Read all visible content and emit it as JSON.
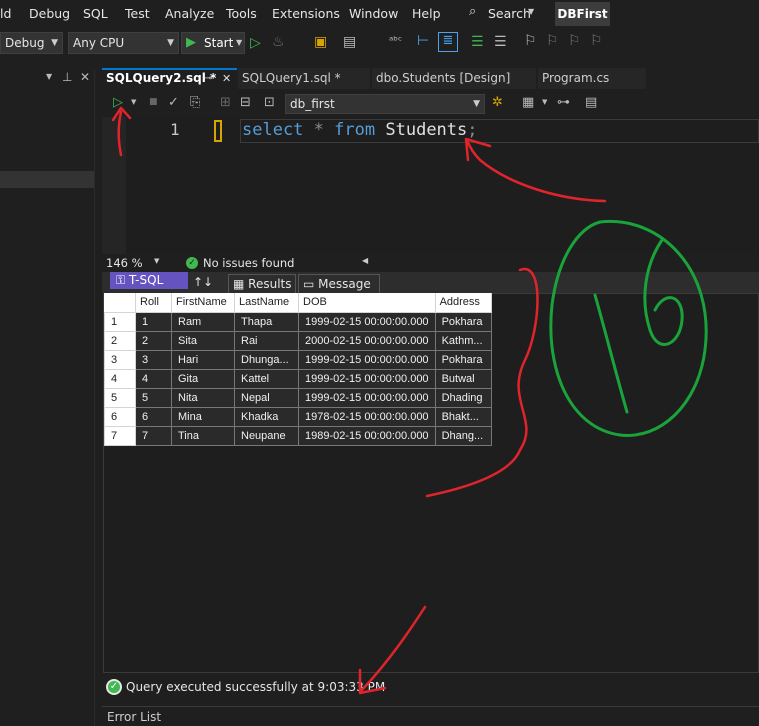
{
  "menu": [
    "ld",
    "Debug",
    "SQL",
    "Test",
    "Analyze",
    "Tools",
    "Extensions",
    "Window",
    "Help"
  ],
  "search_label": "Search",
  "solution_badge": "DBFirst",
  "toolbar": {
    "config": "Debug",
    "platform": "Any CPU",
    "start_label": "Start"
  },
  "tabs": [
    {
      "label": "SQLQuery2.sql *",
      "active": true
    },
    {
      "label": "SQLQuery1.sql *",
      "active": false
    },
    {
      "label": "dbo.Students [Design]",
      "active": false
    },
    {
      "label": "Program.cs",
      "active": false
    }
  ],
  "database": "db_first",
  "editor": {
    "line_number": "1",
    "kw_select": "select",
    "op_star": "*",
    "kw_from": "from",
    "table_name": "Students",
    "semicolon": ";"
  },
  "zoom": "146 %",
  "issues": "No issues found",
  "result_tabs": {
    "tsql": "T-SQL",
    "results": "Results",
    "messages": "Message"
  },
  "grid": {
    "columns": [
      "Roll",
      "FirstName",
      "LastName",
      "DOB",
      "Address"
    ],
    "rows": [
      [
        "1",
        "1",
        "Ram",
        "Thapa",
        "1999-02-15 00:00:00.000",
        "Pokhara"
      ],
      [
        "2",
        "2",
        "Sita",
        "Rai",
        "2000-02-15 00:00:00.000",
        "Kathm..."
      ],
      [
        "3",
        "3",
        "Hari",
        "Dhunga...",
        "1999-02-15 00:00:00.000",
        "Pokhara"
      ],
      [
        "4",
        "4",
        "Gita",
        "Kattel",
        "1999-02-15 00:00:00.000",
        "Butwal"
      ],
      [
        "5",
        "5",
        "Nita",
        "Nepal",
        "1999-02-15 00:00:00.000",
        "Dhading"
      ],
      [
        "6",
        "6",
        "Mina",
        "Khadka",
        "1978-02-15 00:00:00.000",
        "Bhakt..."
      ],
      [
        "7",
        "7",
        "Tina",
        "Neupane",
        "1989-02-15 00:00:00.000",
        "Dhang..."
      ]
    ]
  },
  "status": "Query executed successfully at 9:03:33 PM",
  "error_list": "Error List",
  "colors": {
    "accent": "#0078d4",
    "tsql_tab": "#6554c0",
    "keyword": "#569cd6",
    "annotation_red": "#e0242b",
    "annotation_green": "#1aa33a"
  }
}
